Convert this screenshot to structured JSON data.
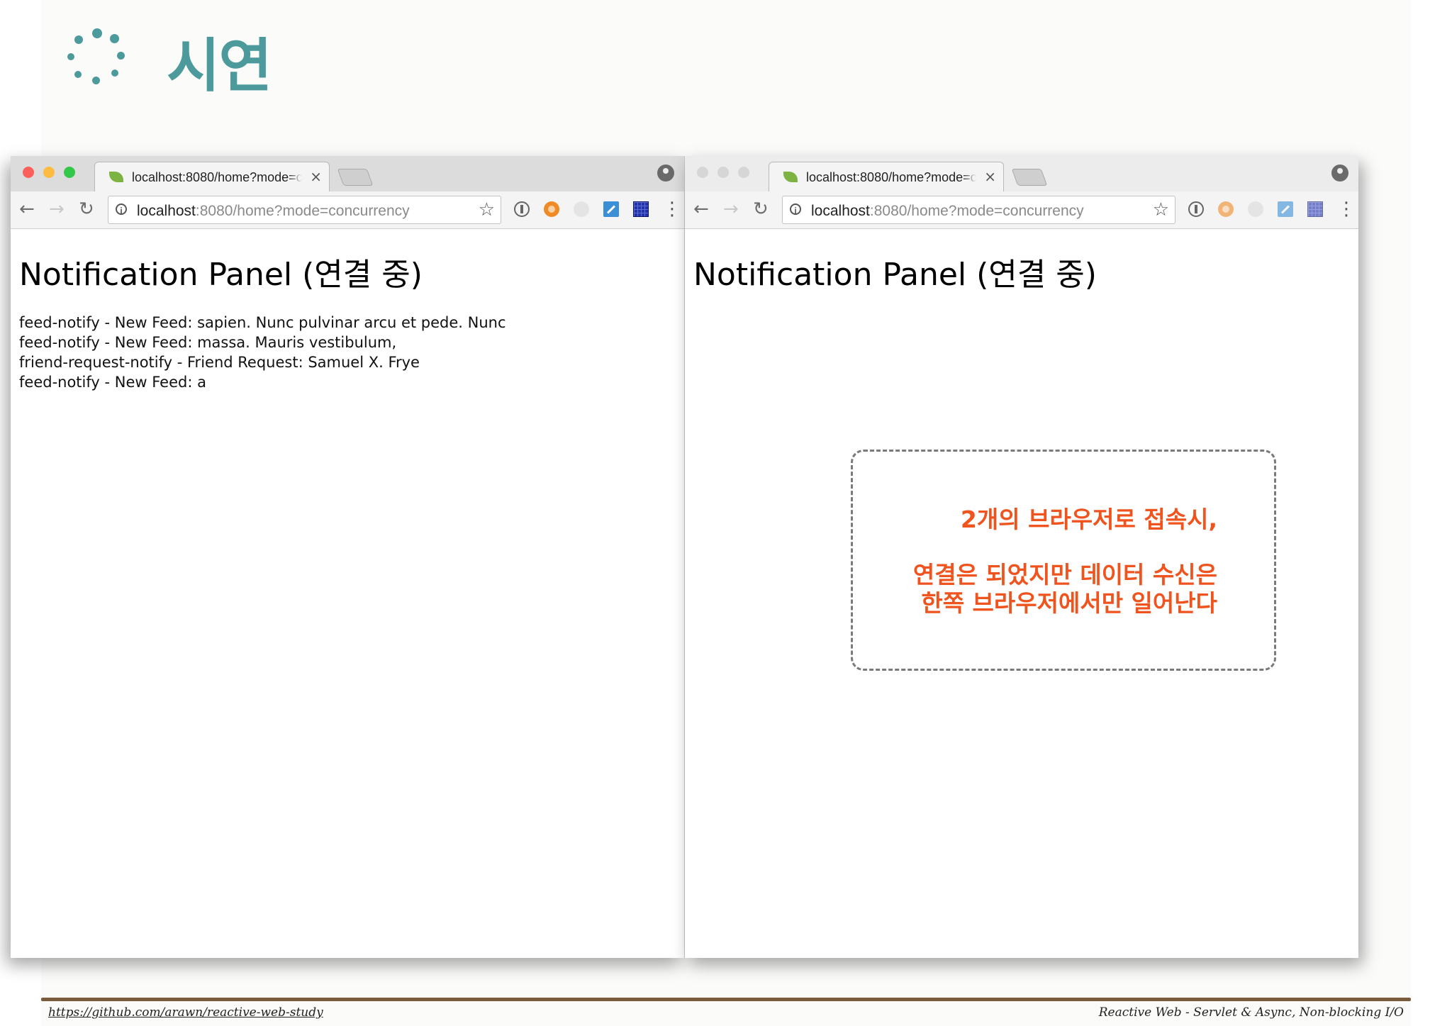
{
  "slide": {
    "title": "시연",
    "footer_link": "https://github.com/arawn/reactive-web-study",
    "footer_note": "Reactive Web - Servlet & Async, Non-blocking I/O"
  },
  "colors": {
    "title_teal": "#4d9a9c",
    "callout_orange": "#f0541e",
    "footer_rule": "#7a5c3c",
    "traffic_red": "#fc605b",
    "traffic_yellow": "#fdbc40",
    "traffic_green": "#34c84a"
  },
  "browser_left": {
    "tab_title": "localhost:8080/home?mode=c",
    "tab_close": "×",
    "url_host": "localhost",
    "url_rest": ":8080/home?mode=concurrency",
    "nav_back": "←",
    "nav_forward": "→",
    "nav_reload": "↻",
    "star": "☆",
    "menu": "⋮",
    "heading": "Notification Panel (연결 중)",
    "notifications": [
      "feed-notify - New Feed: sapien. Nunc pulvinar arcu et pede. Nunc",
      "feed-notify - New Feed: massa. Mauris vestibulum,",
      "friend-request-notify - Friend Request: Samuel X. Frye",
      "feed-notify - New Feed: a"
    ]
  },
  "browser_right": {
    "tab_title": "localhost:8080/home?mode=c",
    "tab_close": "×",
    "url_host": "localhost",
    "url_rest": ":8080/home?mode=concurrency",
    "nav_back": "←",
    "nav_forward": "→",
    "nav_reload": "↻",
    "star": "☆",
    "menu": "⋮",
    "heading": "Notification Panel (연결 중)",
    "notifications": []
  },
  "callout": {
    "line1": "2개의 브라우저로 접속시,",
    "line2": "연결은 되었지만 데이터 수신은",
    "line3": "한쪽 브라우저에서만 일어난다"
  },
  "icons": [
    "spinner-icon",
    "spring-leaf-favicon",
    "info-icon",
    "star-icon",
    "profile-icon",
    "extension-icons",
    "menu-icon"
  ]
}
